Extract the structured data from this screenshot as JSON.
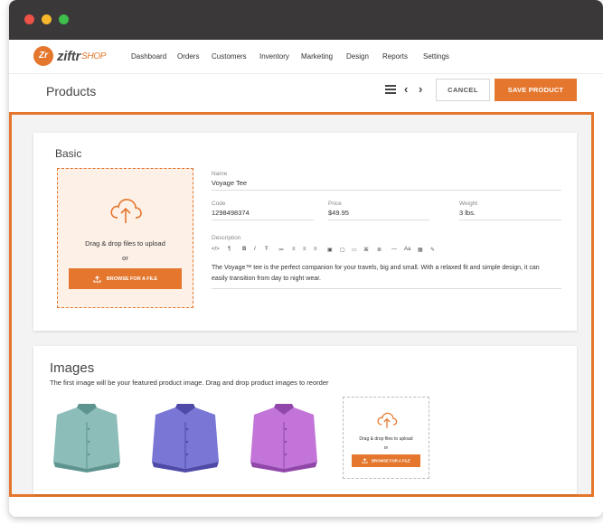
{
  "window": {
    "controls": [
      "close",
      "minimize",
      "maximize"
    ]
  },
  "brand": {
    "logo_mark": "Zr",
    "name": "ziftr",
    "suffix": "SHOP",
    "accent": "#e4762d"
  },
  "nav": {
    "items": [
      "Dashboard",
      "Orders",
      "Customers",
      "Inventory",
      "Marketing",
      "Design",
      "Reports",
      "Settings"
    ]
  },
  "header": {
    "title": "Products",
    "menu_icon": "hamburger-icon",
    "prev_icon": "chevron-left-icon",
    "next_icon": "chevron-right-icon",
    "cancel_label": "CANCEL",
    "save_label": "SAVE PRODUCT"
  },
  "basic": {
    "title": "Basic",
    "upload": {
      "icon": "cloud-upload-icon",
      "text": "Drag & drop files to upload",
      "or": "or",
      "button": "BROWSE FOR A FILE"
    },
    "fields": {
      "name_label": "Name",
      "name_value": "Voyage Tee",
      "code_label": "Code",
      "code_value": "1298498374",
      "price_label": "Price",
      "price_value": "$49.95",
      "weight_label": "Weight",
      "weight_value": "3 lbs.",
      "description_label": "Description",
      "description_text": "The Voyage™ tee is the perfect companion for your travels, big and small. With a relaxed fit and simple design, it can easily transition from day to night wear."
    },
    "editor_tools": [
      "</>",
      "¶",
      "B",
      "I",
      "Ŧ",
      "≔",
      "≡",
      "≡",
      "≡",
      "▣",
      "▢",
      "▭",
      "⌘",
      "≣",
      "—",
      "Aa",
      "▦",
      "✎"
    ]
  },
  "images": {
    "title": "Images",
    "subtitle": "The first image will be your featured product image. Drag and drop product images to reorder",
    "shirts": [
      {
        "color": "#8cbdb8",
        "shade": "#5e948f"
      },
      {
        "color": "#7a76d6",
        "shade": "#4f4aa8"
      },
      {
        "color": "#c274d8",
        "shade": "#9147aa"
      }
    ],
    "upload": {
      "icon": "cloud-upload-icon",
      "text": "Drag & drop files to upload",
      "or": "or",
      "button": "BROWSE FOR A FILE"
    }
  }
}
